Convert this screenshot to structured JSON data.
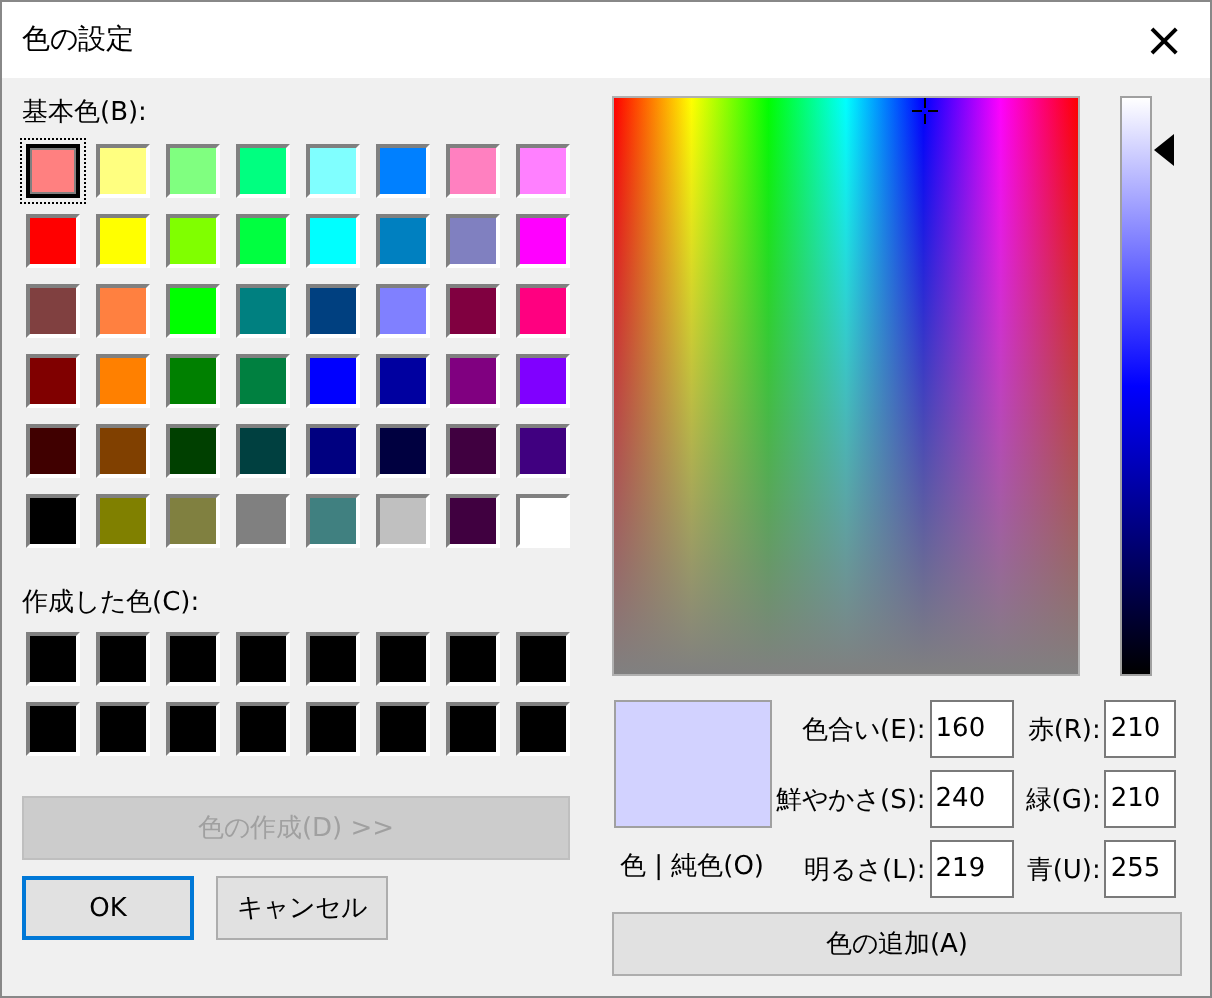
{
  "window": {
    "title": "色の設定",
    "close": "×"
  },
  "basic_colors": {
    "label": "基本色(B):",
    "swatches": [
      {
        "color": "#ff8080",
        "selected": true
      },
      {
        "color": "#ffff80",
        "selected": false
      },
      {
        "color": "#80ff80",
        "selected": false
      },
      {
        "color": "#00ff80",
        "selected": false
      },
      {
        "color": "#80ffff",
        "selected": false
      },
      {
        "color": "#0080ff",
        "selected": false
      },
      {
        "color": "#ff80c0",
        "selected": false
      },
      {
        "color": "#ff80ff",
        "selected": false
      },
      {
        "color": "#ff0000",
        "selected": false
      },
      {
        "color": "#ffff00",
        "selected": false
      },
      {
        "color": "#80ff00",
        "selected": false
      },
      {
        "color": "#00ff40",
        "selected": false
      },
      {
        "color": "#00ffff",
        "selected": false
      },
      {
        "color": "#0080c0",
        "selected": false
      },
      {
        "color": "#8080c0",
        "selected": false
      },
      {
        "color": "#ff00ff",
        "selected": false
      },
      {
        "color": "#804040",
        "selected": false
      },
      {
        "color": "#ff8040",
        "selected": false
      },
      {
        "color": "#00ff00",
        "selected": false
      },
      {
        "color": "#008080",
        "selected": false
      },
      {
        "color": "#004080",
        "selected": false
      },
      {
        "color": "#8080ff",
        "selected": false
      },
      {
        "color": "#800040",
        "selected": false
      },
      {
        "color": "#ff0080",
        "selected": false
      },
      {
        "color": "#800000",
        "selected": false
      },
      {
        "color": "#ff8000",
        "selected": false
      },
      {
        "color": "#008000",
        "selected": false
      },
      {
        "color": "#008040",
        "selected": false
      },
      {
        "color": "#0000ff",
        "selected": false
      },
      {
        "color": "#0000a0",
        "selected": false
      },
      {
        "color": "#800080",
        "selected": false
      },
      {
        "color": "#8000ff",
        "selected": false
      },
      {
        "color": "#400000",
        "selected": false
      },
      {
        "color": "#804000",
        "selected": false
      },
      {
        "color": "#004000",
        "selected": false
      },
      {
        "color": "#004040",
        "selected": false
      },
      {
        "color": "#000080",
        "selected": false
      },
      {
        "color": "#000040",
        "selected": false
      },
      {
        "color": "#400040",
        "selected": false
      },
      {
        "color": "#400080",
        "selected": false
      },
      {
        "color": "#000000",
        "selected": false
      },
      {
        "color": "#808000",
        "selected": false
      },
      {
        "color": "#808040",
        "selected": false
      },
      {
        "color": "#808080",
        "selected": false
      },
      {
        "color": "#408080",
        "selected": false
      },
      {
        "color": "#c0c0c0",
        "selected": false
      },
      {
        "color": "#400040",
        "selected": false
      },
      {
        "color": "#ffffff",
        "selected": false
      }
    ]
  },
  "custom_colors": {
    "label": "作成した色(C):",
    "swatches": [
      {
        "color": "#000000",
        "selected": false
      },
      {
        "color": "#000000",
        "selected": false
      },
      {
        "color": "#000000",
        "selected": false
      },
      {
        "color": "#000000",
        "selected": false
      },
      {
        "color": "#000000",
        "selected": false
      },
      {
        "color": "#000000",
        "selected": false
      },
      {
        "color": "#000000",
        "selected": false
      },
      {
        "color": "#000000",
        "selected": false
      },
      {
        "color": "#000000",
        "selected": false
      },
      {
        "color": "#000000",
        "selected": false
      },
      {
        "color": "#000000",
        "selected": false
      },
      {
        "color": "#000000",
        "selected": false
      },
      {
        "color": "#000000",
        "selected": false
      },
      {
        "color": "#000000",
        "selected": false
      },
      {
        "color": "#000000",
        "selected": false
      },
      {
        "color": "#000000",
        "selected": false
      }
    ]
  },
  "define_button": {
    "label": "色の作成(D) >>",
    "disabled": true
  },
  "buttons": [
    {
      "label": "OK",
      "default": true
    },
    {
      "label": "キャンセル",
      "default": false
    }
  ],
  "luminance": {
    "level": 0.91
  },
  "preview": {
    "color": "#d2d2ff",
    "label": "色 | 純色(O)"
  },
  "fields": [
    {
      "label": "色合い(E):",
      "value": "160"
    },
    {
      "label": "赤(R):",
      "value": "210"
    },
    {
      "label": "鮮やかさ(S):",
      "value": "240"
    },
    {
      "label": "緑(G):",
      "value": "210"
    },
    {
      "label": "明るさ(L):",
      "value": "219"
    },
    {
      "label": "青(U):",
      "value": "255"
    }
  ],
  "add_button": {
    "label": "色の追加(A)"
  }
}
